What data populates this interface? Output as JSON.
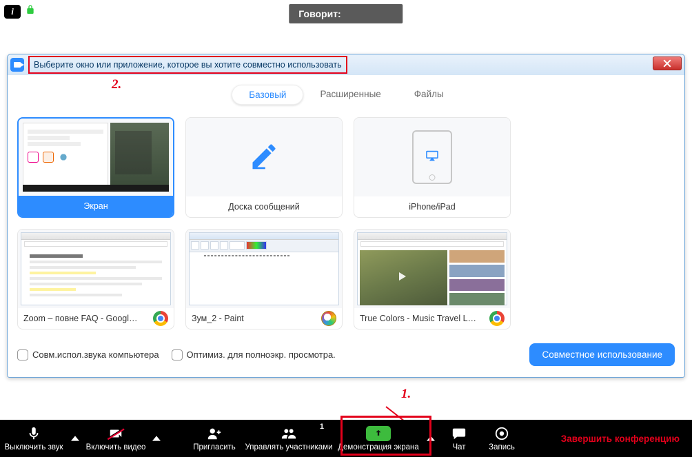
{
  "top": {
    "speaking_label": "Говорит:"
  },
  "dialog": {
    "title": "Выберите окно или приложение, которое вы хотите совместно использовать",
    "tabs": {
      "basic": "Базовый",
      "advanced": "Расширенные",
      "files": "Файлы"
    },
    "cards": {
      "screen": "Экран",
      "whiteboard": "Доска сообщений",
      "iphone": "iPhone/iPad",
      "win1": "Zoom – повне FAQ - Google Док...",
      "win2": "Зум_2 - Paint",
      "win3": "True Colors - Music Travel Love (..."
    },
    "checkbox_audio": "Совм.испол.звука компьютера",
    "checkbox_optimize": "Оптимиз. для полноэкр. просмотра.",
    "share_button": "Совместное использование"
  },
  "annotations": {
    "one": "1.",
    "two": "2."
  },
  "toolbar": {
    "mute": "Выключить звук",
    "video": "Включить видео",
    "invite": "Пригласить",
    "manage": "Управлять участниками",
    "manage_count": "1",
    "share": "Демонстрация экрана",
    "chat": "Чат",
    "record": "Запись",
    "end": "Завершить конференцию"
  }
}
